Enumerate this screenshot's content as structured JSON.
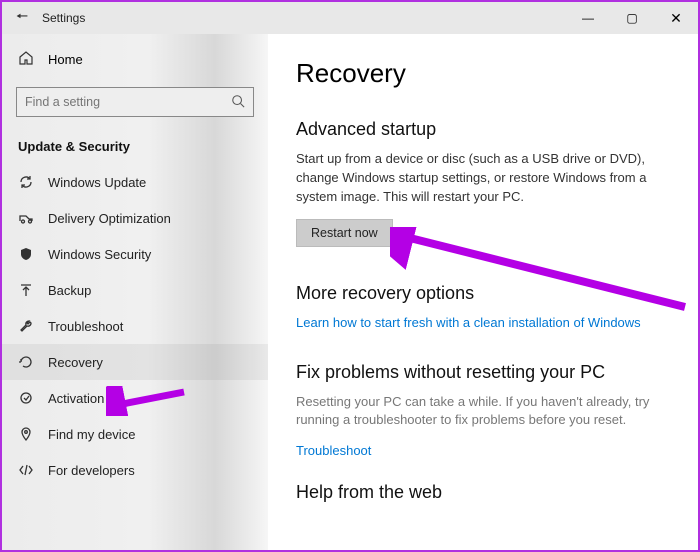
{
  "titlebar": {
    "title": "Settings"
  },
  "sidebar": {
    "home_label": "Home",
    "search_placeholder": "Find a setting",
    "category": "Update & Security",
    "items": [
      {
        "label": "Windows Update"
      },
      {
        "label": "Delivery Optimization"
      },
      {
        "label": "Windows Security"
      },
      {
        "label": "Backup"
      },
      {
        "label": "Troubleshoot"
      },
      {
        "label": "Recovery"
      },
      {
        "label": "Activation"
      },
      {
        "label": "Find my device"
      },
      {
        "label": "For developers"
      }
    ]
  },
  "content": {
    "page_title": "Recovery",
    "advanced": {
      "heading": "Advanced startup",
      "desc": "Start up from a device or disc (such as a USB drive or DVD), change Windows startup settings, or restore Windows from a system image. This will restart your PC.",
      "button": "Restart now"
    },
    "more": {
      "heading": "More recovery options",
      "link": "Learn how to start fresh with a clean installation of Windows"
    },
    "fix": {
      "heading": "Fix problems without resetting your PC",
      "desc": "Resetting your PC can take a while. If you haven't already, try running a troubleshooter to fix problems before you reset.",
      "link": "Troubleshoot"
    },
    "help": {
      "heading": "Help from the web"
    }
  }
}
